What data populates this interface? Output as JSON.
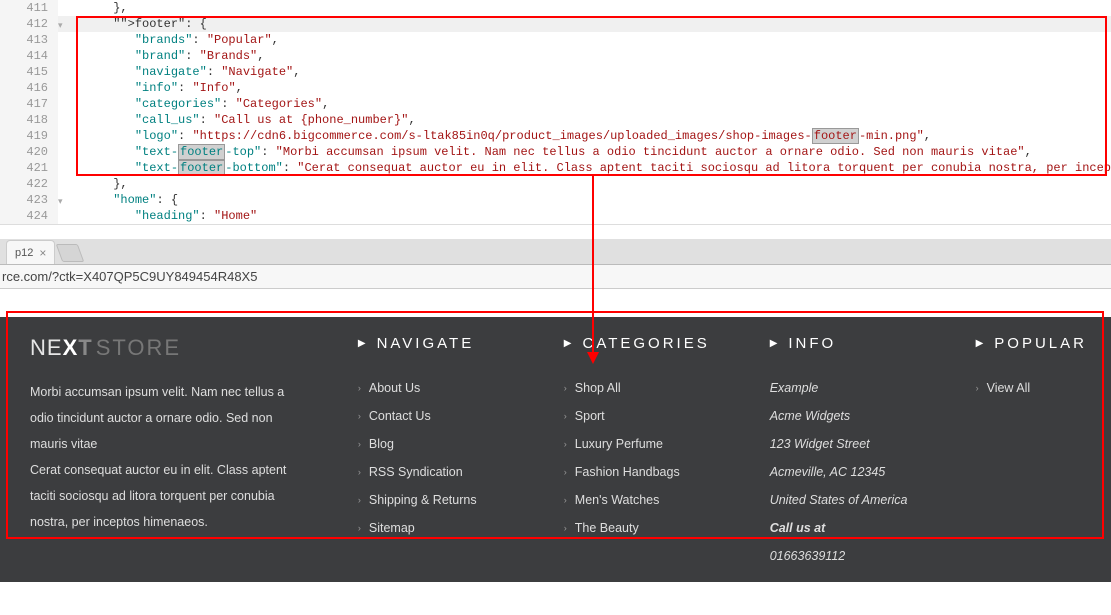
{
  "editor": {
    "lines": [
      {
        "num": "411",
        "fold": "",
        "code": "      },"
      },
      {
        "num": "412",
        "fold": "▾",
        "code": "      \"footer\": {",
        "active": true,
        "highlight_footer": true
      },
      {
        "num": "413",
        "fold": "",
        "code": "         \"brands\": \"Popular\","
      },
      {
        "num": "414",
        "fold": "",
        "code": "         \"brand\":\"Brands\","
      },
      {
        "num": "415",
        "fold": "",
        "code": "         \"navigate\": \"Navigate\","
      },
      {
        "num": "416",
        "fold": "",
        "code": "         \"info\": \"Info\","
      },
      {
        "num": "417",
        "fold": "",
        "code": "         \"categories\": \"Categories\","
      },
      {
        "num": "418",
        "fold": "",
        "code": "         \"call_us\": \"Call us at {phone_number}\","
      },
      {
        "num": "419",
        "fold": "",
        "code": "         \"logo\":\"https://cdn6.bigcommerce.com/s-ltak85in0q/product_images/uploaded_images/shop-images-footer-min.png\",",
        "highlight_footer_mid": true
      },
      {
        "num": "420",
        "fold": "",
        "code": "         \"text-footer-top\":\"Morbi accumsan ipsum velit. Nam nec tellus a odio tincidunt auctor a ornare odio. Sed non mauris vitae\",",
        "highlight_footer_mid": true
      },
      {
        "num": "421",
        "fold": "",
        "code": "         \"text-footer-bottom\":\"Cerat consequat auctor eu in elit. Class aptent taciti sociosqu ad litora torquent per conubia nostra, per inceptos himenaeos.\"",
        "highlight_footer_mid": true
      },
      {
        "num": "422",
        "fold": "",
        "code": "      },"
      },
      {
        "num": "423",
        "fold": "▾",
        "code": "      \"home\": {"
      },
      {
        "num": "424",
        "fold": "",
        "code": "         \"heading\": \"Home\""
      }
    ]
  },
  "tab_label": "p12",
  "url": "rce.com/?ctk=X407QP5C9UY849454R48X5",
  "footer": {
    "logo_a": "NE",
    "logo_b": "X",
    "logo_c": "T",
    "logo_d": "STORE",
    "text_top": "Morbi accumsan ipsum velit. Nam nec tellus a odio tincidunt auctor a ornare odio. Sed non mauris vitae",
    "text_bottom": "Cerat consequat auctor eu in elit. Class aptent taciti sociosqu ad litora torquent per conubia nostra, per inceptos himenaeos.",
    "navigate": {
      "title": "Navigate",
      "items": [
        "About Us",
        "Contact Us",
        "Blog",
        "RSS Syndication",
        "Shipping & Returns",
        "Sitemap"
      ]
    },
    "categories": {
      "title": "Categories",
      "items": [
        "Shop All",
        "Sport",
        "Luxury Perfume",
        "Fashion Handbags",
        "Men's Watches",
        "The Beauty"
      ]
    },
    "info": {
      "title": "Info",
      "lines": [
        "Example",
        "Acme Widgets",
        "123 Widget Street",
        "Acmeville, AC 12345"
      ],
      "country": "United States of America",
      "call": "Call us at",
      "phone": "01663639112"
    },
    "popular": {
      "title": "Popular",
      "items": [
        "View All"
      ]
    }
  }
}
